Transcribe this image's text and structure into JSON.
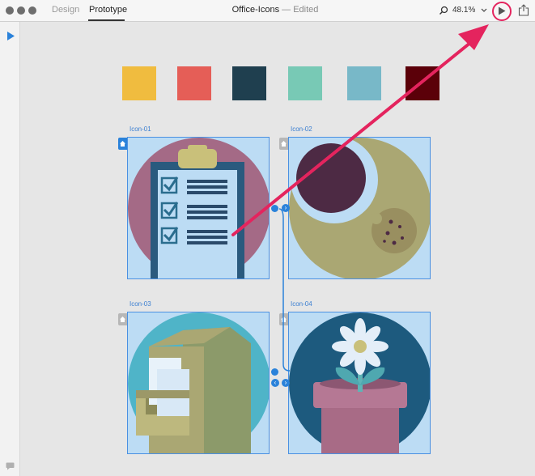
{
  "window": {
    "tabs": [
      {
        "label": "Design",
        "active": false
      },
      {
        "label": "Prototype",
        "active": true
      }
    ],
    "doc_name": "Office-Icons",
    "doc_status": " — Edited",
    "zoom": "48.1%",
    "icons": {
      "close": "traffic-light-close",
      "minimize": "traffic-light-minimize",
      "zoom": "traffic-light-zoom",
      "search": "search-icon",
      "chevron": "chevron-down-icon",
      "play": "play-icon",
      "share": "share-icon"
    },
    "highlight_color": "#e4245e"
  },
  "swatches": [
    "#f0bc3f",
    "#e55e57",
    "#1f3f4f",
    "#78c9b5",
    "#78b8c8",
    "#5b0009"
  ],
  "artboards": [
    {
      "label": "Icon-01",
      "home": true,
      "icon": "clipboard-checklist",
      "circle": "#a46a86"
    },
    {
      "label": "Icon-02",
      "home": false,
      "icon": "moon-cookie",
      "circle": "#aaa773"
    },
    {
      "label": "Icon-03",
      "home": false,
      "icon": "filing-cabinet",
      "circle": "#4fb4c8"
    },
    {
      "label": "Icon-04",
      "home": false,
      "icon": "potted-flower",
      "circle": "#1d5a7e"
    }
  ],
  "accent": "#2a82da"
}
